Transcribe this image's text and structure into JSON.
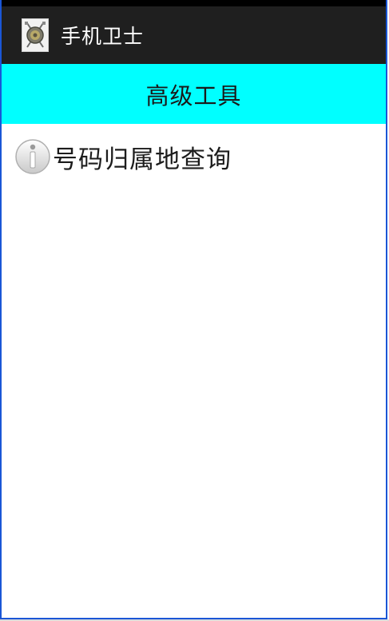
{
  "app": {
    "title": "手机卫士",
    "icon": "shield-guard-icon"
  },
  "header": {
    "title": "高级工具",
    "background": "#00ffff"
  },
  "tools": [
    {
      "label": "号码归属地查询",
      "icon": "info-icon"
    }
  ],
  "colors": {
    "action_bar": "#1f1f1f",
    "window_border": "#1a56d6"
  }
}
